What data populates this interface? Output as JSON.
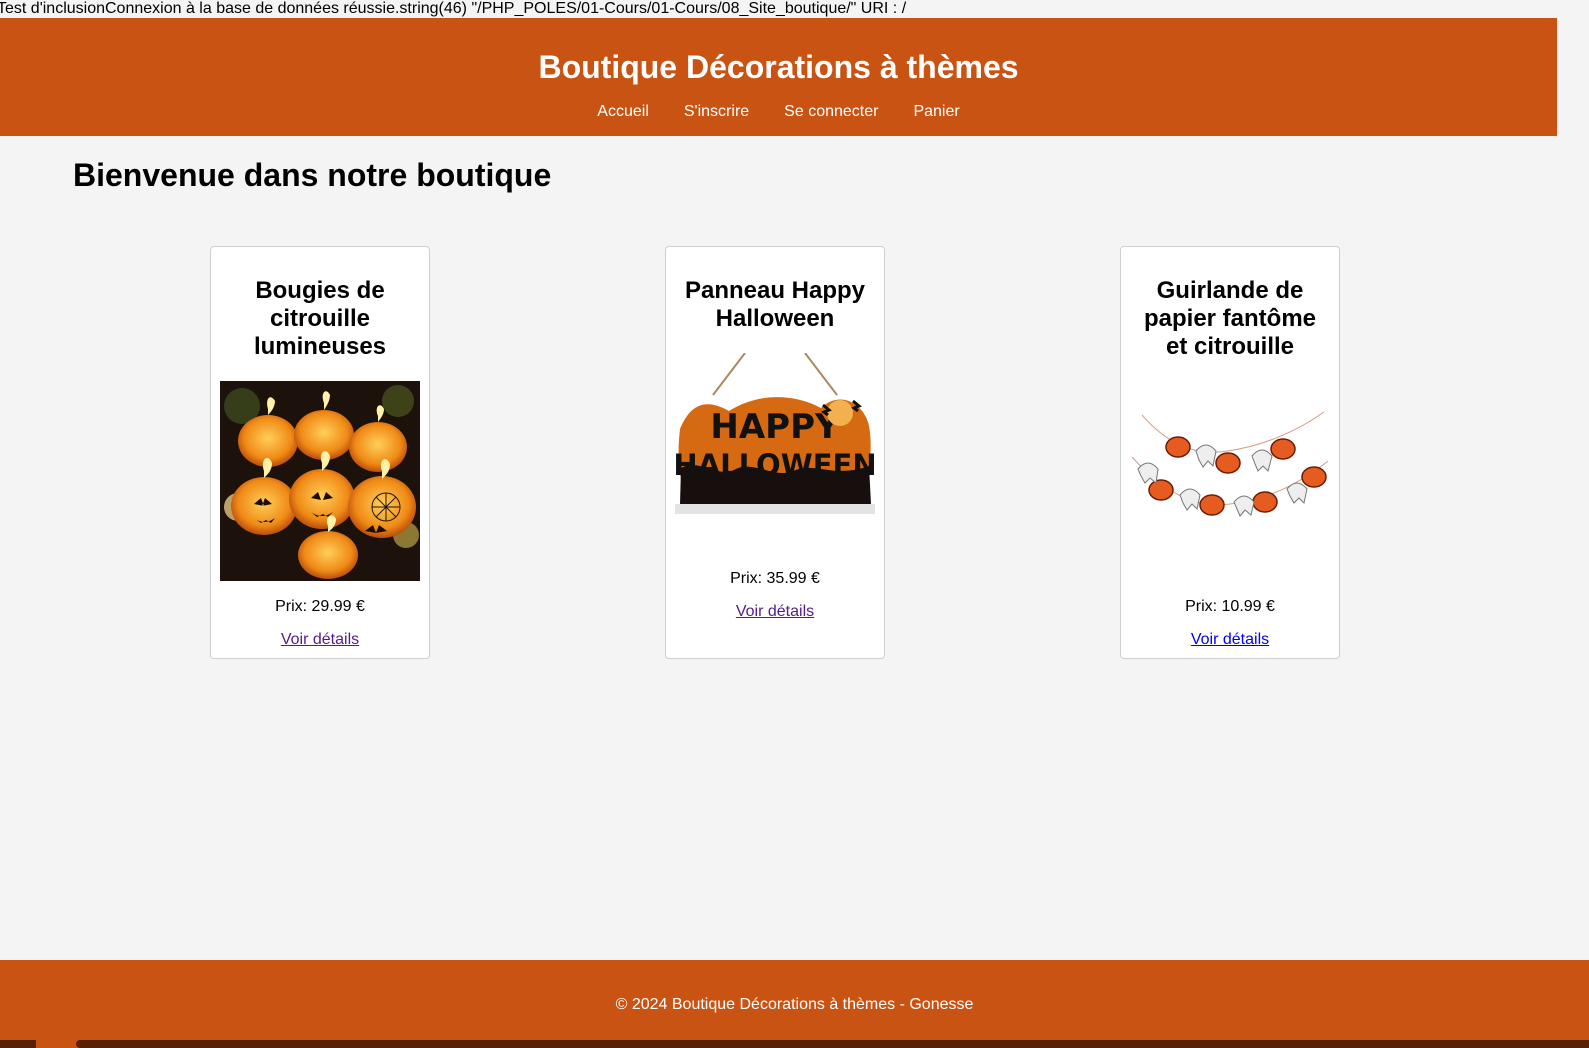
{
  "debug": {
    "text": "Test d'inclusionConnexion à la base de données réussie.string(46) \"/PHP_POLES/01-Cours/01-Cours/08_Site_boutique/\" URI : /"
  },
  "header": {
    "title": "Boutique Décorations à thèmes",
    "nav": [
      "Accueil",
      "S'inscrire",
      "Se connecter",
      "Panier"
    ]
  },
  "main": {
    "heading": "Bienvenue dans notre boutique",
    "products": [
      {
        "name": "Bougies de citrouille lumineuses",
        "price": "Prix: 29.99 €",
        "link": "Voir détails",
        "icon": "pumpkin-candles-image"
      },
      {
        "name": "Panneau Happy Halloween",
        "price": "Prix: 35.99 €",
        "link": "Voir détails",
        "icon": "happy-halloween-sign-image",
        "image_text": [
          "HAPPY",
          "HALLOWEEN"
        ]
      },
      {
        "name": "Guirlande de papier fantôme et citrouille",
        "price": "Prix: 10.99 €",
        "link": "Voir détails",
        "icon": "ghost-pumpkin-garland-image"
      }
    ]
  },
  "footer": {
    "text": "© 2024 Boutique Décorations à thèmes - Gonesse"
  },
  "colors": {
    "header": "#c95313",
    "footer": "#c95313",
    "background": "#f4f4f4",
    "visited_link": "#551a8b",
    "link": "#0000ee"
  }
}
